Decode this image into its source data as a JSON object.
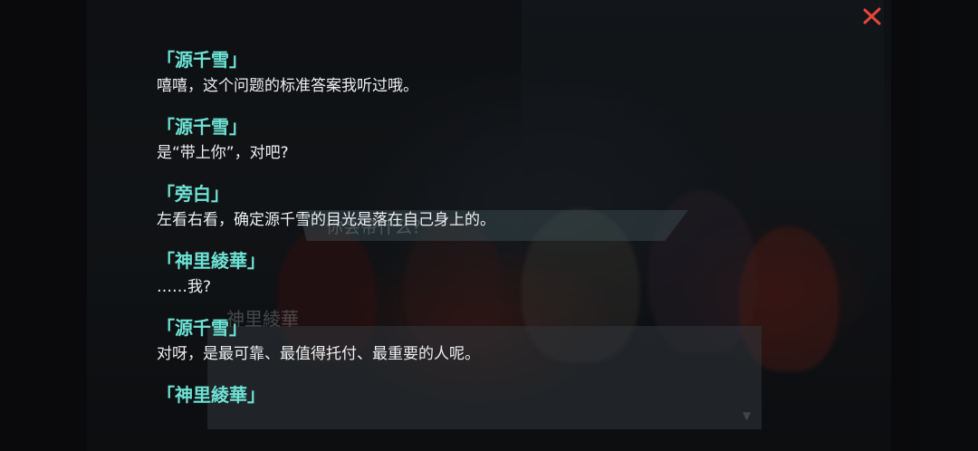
{
  "scene": {
    "question": "你会带什么？",
    "dialogue_name": "神里綾華"
  },
  "log": [
    {
      "speaker": "「源千雪」",
      "text": "嘻嘻，这个问题的标准答案我听过哦。"
    },
    {
      "speaker": "「源千雪」",
      "text": "是“带上你”，对吧?"
    },
    {
      "speaker": "「旁白」",
      "text": "左看右看，确定源千雪的目光是落在自己身上的。"
    },
    {
      "speaker": "「神里綾華」",
      "text": "……我?"
    },
    {
      "speaker": "「源千雪」",
      "text": "对呀，是最可靠、最值得托付、最重要的人呢。"
    },
    {
      "speaker": "「神里綾華」",
      "text": ""
    }
  ],
  "controls": {
    "close_icon": "close-x-icon",
    "accent_color": "#e8453c",
    "speaker_color": "#6ee3d6"
  }
}
